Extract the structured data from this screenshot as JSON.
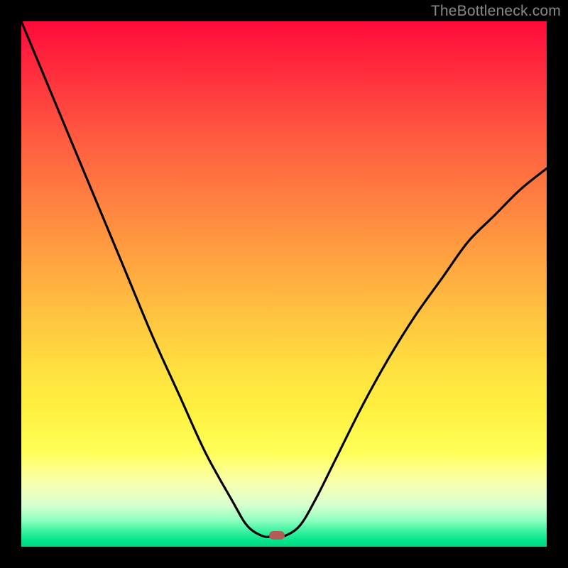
{
  "watermark": "TheBottleneck.com",
  "marker": {
    "x_frac": 0.486,
    "y_frac": 0.979
  },
  "colors": {
    "background": "#000000",
    "marker": "#b65a56",
    "watermark": "#8a8a8a",
    "curve": "#000000"
  },
  "chart_data": {
    "type": "line",
    "title": "",
    "xlabel": "",
    "ylabel": "",
    "xlim": [
      0,
      1
    ],
    "ylim": [
      0,
      1
    ],
    "grid": false,
    "legend": false,
    "annotations": [
      "TheBottleneck.com"
    ],
    "series": [
      {
        "name": "bottleneck-curve",
        "x": [
          0.0,
          0.05,
          0.1,
          0.15,
          0.2,
          0.25,
          0.3,
          0.35,
          0.4,
          0.43,
          0.46,
          0.48,
          0.5,
          0.53,
          0.56,
          0.6,
          0.65,
          0.7,
          0.75,
          0.8,
          0.85,
          0.9,
          0.95,
          1.0
        ],
        "y": [
          1.0,
          0.88,
          0.76,
          0.64,
          0.52,
          0.4,
          0.29,
          0.18,
          0.09,
          0.04,
          0.02,
          0.02,
          0.02,
          0.04,
          0.09,
          0.17,
          0.27,
          0.36,
          0.44,
          0.51,
          0.58,
          0.63,
          0.68,
          0.72
        ]
      }
    ],
    "background_gradient": {
      "top": "#ff0a3a",
      "mid": "#ffe040",
      "bottom": "#00d880"
    },
    "marker_point": {
      "x": 0.486,
      "y": 0.021
    }
  }
}
